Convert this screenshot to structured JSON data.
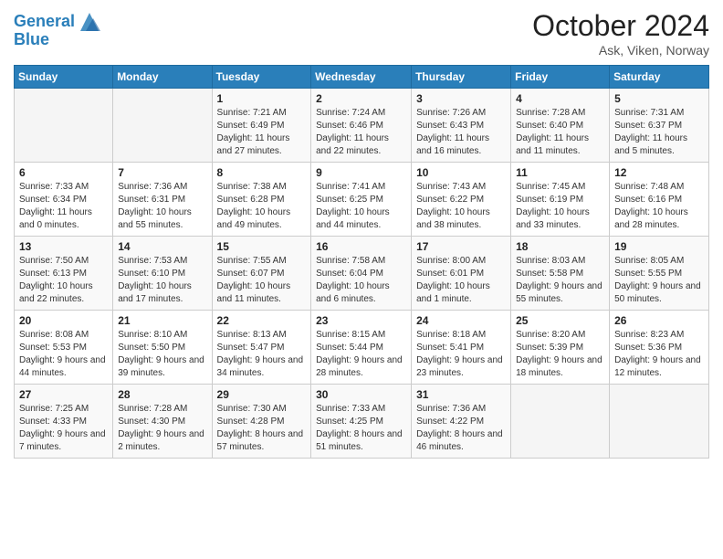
{
  "header": {
    "logo_line1": "General",
    "logo_line2": "Blue",
    "month": "October 2024",
    "location": "Ask, Viken, Norway"
  },
  "weekdays": [
    "Sunday",
    "Monday",
    "Tuesday",
    "Wednesday",
    "Thursday",
    "Friday",
    "Saturday"
  ],
  "weeks": [
    [
      {
        "day": "",
        "info": ""
      },
      {
        "day": "",
        "info": ""
      },
      {
        "day": "1",
        "info": "Sunrise: 7:21 AM\nSunset: 6:49 PM\nDaylight: 11 hours and 27 minutes."
      },
      {
        "day": "2",
        "info": "Sunrise: 7:24 AM\nSunset: 6:46 PM\nDaylight: 11 hours and 22 minutes."
      },
      {
        "day": "3",
        "info": "Sunrise: 7:26 AM\nSunset: 6:43 PM\nDaylight: 11 hours and 16 minutes."
      },
      {
        "day": "4",
        "info": "Sunrise: 7:28 AM\nSunset: 6:40 PM\nDaylight: 11 hours and 11 minutes."
      },
      {
        "day": "5",
        "info": "Sunrise: 7:31 AM\nSunset: 6:37 PM\nDaylight: 11 hours and 5 minutes."
      }
    ],
    [
      {
        "day": "6",
        "info": "Sunrise: 7:33 AM\nSunset: 6:34 PM\nDaylight: 11 hours and 0 minutes."
      },
      {
        "day": "7",
        "info": "Sunrise: 7:36 AM\nSunset: 6:31 PM\nDaylight: 10 hours and 55 minutes."
      },
      {
        "day": "8",
        "info": "Sunrise: 7:38 AM\nSunset: 6:28 PM\nDaylight: 10 hours and 49 minutes."
      },
      {
        "day": "9",
        "info": "Sunrise: 7:41 AM\nSunset: 6:25 PM\nDaylight: 10 hours and 44 minutes."
      },
      {
        "day": "10",
        "info": "Sunrise: 7:43 AM\nSunset: 6:22 PM\nDaylight: 10 hours and 38 minutes."
      },
      {
        "day": "11",
        "info": "Sunrise: 7:45 AM\nSunset: 6:19 PM\nDaylight: 10 hours and 33 minutes."
      },
      {
        "day": "12",
        "info": "Sunrise: 7:48 AM\nSunset: 6:16 PM\nDaylight: 10 hours and 28 minutes."
      }
    ],
    [
      {
        "day": "13",
        "info": "Sunrise: 7:50 AM\nSunset: 6:13 PM\nDaylight: 10 hours and 22 minutes."
      },
      {
        "day": "14",
        "info": "Sunrise: 7:53 AM\nSunset: 6:10 PM\nDaylight: 10 hours and 17 minutes."
      },
      {
        "day": "15",
        "info": "Sunrise: 7:55 AM\nSunset: 6:07 PM\nDaylight: 10 hours and 11 minutes."
      },
      {
        "day": "16",
        "info": "Sunrise: 7:58 AM\nSunset: 6:04 PM\nDaylight: 10 hours and 6 minutes."
      },
      {
        "day": "17",
        "info": "Sunrise: 8:00 AM\nSunset: 6:01 PM\nDaylight: 10 hours and 1 minute."
      },
      {
        "day": "18",
        "info": "Sunrise: 8:03 AM\nSunset: 5:58 PM\nDaylight: 9 hours and 55 minutes."
      },
      {
        "day": "19",
        "info": "Sunrise: 8:05 AM\nSunset: 5:55 PM\nDaylight: 9 hours and 50 minutes."
      }
    ],
    [
      {
        "day": "20",
        "info": "Sunrise: 8:08 AM\nSunset: 5:53 PM\nDaylight: 9 hours and 44 minutes."
      },
      {
        "day": "21",
        "info": "Sunrise: 8:10 AM\nSunset: 5:50 PM\nDaylight: 9 hours and 39 minutes."
      },
      {
        "day": "22",
        "info": "Sunrise: 8:13 AM\nSunset: 5:47 PM\nDaylight: 9 hours and 34 minutes."
      },
      {
        "day": "23",
        "info": "Sunrise: 8:15 AM\nSunset: 5:44 PM\nDaylight: 9 hours and 28 minutes."
      },
      {
        "day": "24",
        "info": "Sunrise: 8:18 AM\nSunset: 5:41 PM\nDaylight: 9 hours and 23 minutes."
      },
      {
        "day": "25",
        "info": "Sunrise: 8:20 AM\nSunset: 5:39 PM\nDaylight: 9 hours and 18 minutes."
      },
      {
        "day": "26",
        "info": "Sunrise: 8:23 AM\nSunset: 5:36 PM\nDaylight: 9 hours and 12 minutes."
      }
    ],
    [
      {
        "day": "27",
        "info": "Sunrise: 7:25 AM\nSunset: 4:33 PM\nDaylight: 9 hours and 7 minutes."
      },
      {
        "day": "28",
        "info": "Sunrise: 7:28 AM\nSunset: 4:30 PM\nDaylight: 9 hours and 2 minutes."
      },
      {
        "day": "29",
        "info": "Sunrise: 7:30 AM\nSunset: 4:28 PM\nDaylight: 8 hours and 57 minutes."
      },
      {
        "day": "30",
        "info": "Sunrise: 7:33 AM\nSunset: 4:25 PM\nDaylight: 8 hours and 51 minutes."
      },
      {
        "day": "31",
        "info": "Sunrise: 7:36 AM\nSunset: 4:22 PM\nDaylight: 8 hours and 46 minutes."
      },
      {
        "day": "",
        "info": ""
      },
      {
        "day": "",
        "info": ""
      }
    ]
  ]
}
